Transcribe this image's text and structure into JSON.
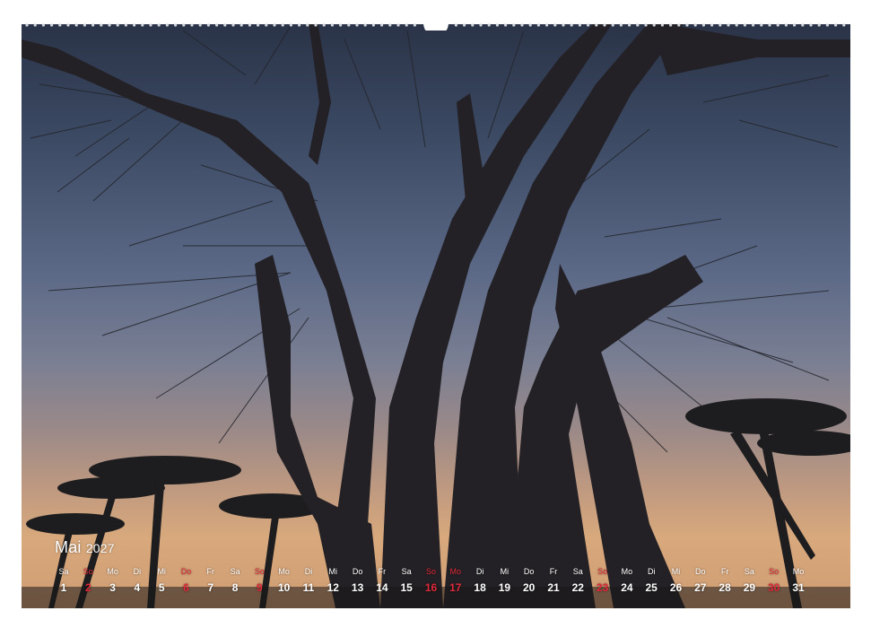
{
  "calendar": {
    "month": "Mai",
    "year": "2027",
    "day_names": [
      "Sa",
      "So",
      "Mo",
      "Di",
      "Mi",
      "Do",
      "Fr",
      "Sa",
      "So",
      "Mo",
      "Di",
      "Mi",
      "Do",
      "Fr",
      "Sa",
      "So",
      "Mo",
      "Di",
      "Mi",
      "Do",
      "Fr",
      "Sa",
      "So",
      "Mo",
      "Di",
      "Mi",
      "Do",
      "Fr",
      "Sa",
      "So",
      "Mo"
    ],
    "days": [
      "1",
      "2",
      "3",
      "4",
      "5",
      "6",
      "7",
      "8",
      "9",
      "10",
      "11",
      "12",
      "13",
      "14",
      "15",
      "16",
      "17",
      "18",
      "19",
      "20",
      "21",
      "22",
      "23",
      "24",
      "25",
      "26",
      "27",
      "28",
      "29",
      "30",
      "31"
    ],
    "highlighted_days": [
      "2",
      "6",
      "9",
      "16",
      "17",
      "23",
      "30"
    ],
    "highlight_color": "#e0293a",
    "text_color": "#ffffff"
  },
  "photo": {
    "subject": "baobab-tree-silhouette-at-dusk"
  }
}
